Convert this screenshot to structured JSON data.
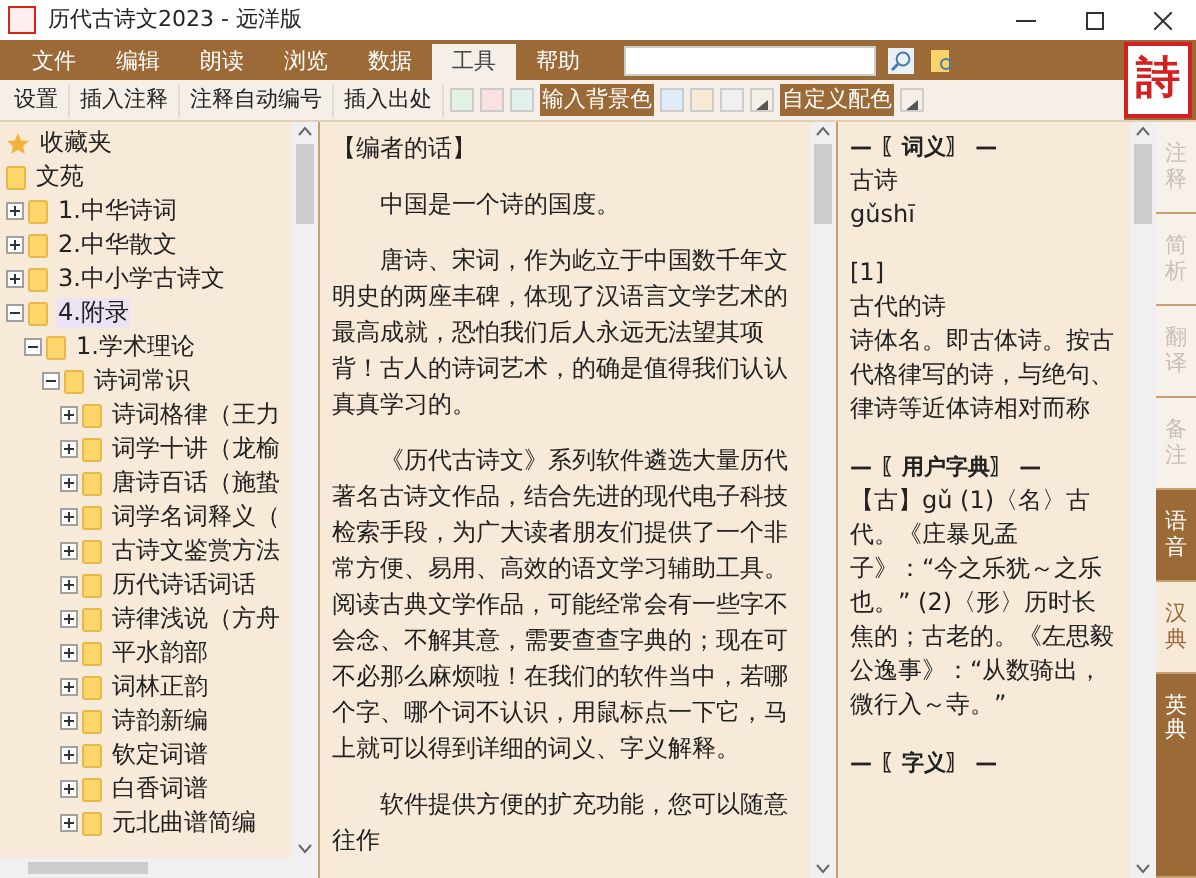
{
  "window": {
    "title": "历代古诗文2023 - 远洋版"
  },
  "menu": [
    {
      "label": "文件",
      "selected": false
    },
    {
      "label": "编辑",
      "selected": false
    },
    {
      "label": "朗读",
      "selected": false
    },
    {
      "label": "浏览",
      "selected": false
    },
    {
      "label": "数据",
      "selected": false
    },
    {
      "label": "工具",
      "selected": true
    },
    {
      "label": "帮助",
      "selected": false
    }
  ],
  "logo": "詩",
  "toolbar": [
    {
      "kind": "button",
      "label": "设置"
    },
    {
      "kind": "button",
      "label": "插入注释"
    },
    {
      "kind": "button",
      "label": "注释自动编号"
    },
    {
      "kind": "button",
      "label": "插入出处"
    },
    {
      "kind": "swatch",
      "color": "#e4f2e4"
    },
    {
      "kind": "swatch",
      "color": "#fbe2e2"
    },
    {
      "kind": "swatch",
      "color": "#e2f2ea"
    },
    {
      "kind": "label",
      "label": "输入背景色"
    },
    {
      "kind": "swatch",
      "color": "#e0ecf8"
    },
    {
      "kind": "swatch",
      "color": "#f8ebd6"
    },
    {
      "kind": "swatch",
      "color": "#f0f0f0"
    },
    {
      "kind": "arrow"
    },
    {
      "kind": "label",
      "label": "自定义配色"
    },
    {
      "kind": "arrow"
    }
  ],
  "tree": [
    {
      "kind": "star",
      "label": "收藏夹"
    },
    {
      "kind": "folder",
      "label": "文苑"
    },
    {
      "kind": "folder",
      "label": "1.中华诗词",
      "expanded": false
    },
    {
      "kind": "folder",
      "label": "2.中华散文",
      "expanded": false
    },
    {
      "kind": "folder",
      "label": "3.中小学古诗文",
      "expanded": false
    },
    {
      "kind": "folder",
      "label": "4.附录",
      "expanded": true,
      "selected": true,
      "children": [
        {
          "kind": "folder",
          "label": "1.学术理论",
          "expanded": true,
          "children": [
            {
              "kind": "folder",
              "label": "诗词常识",
              "expanded": true,
              "children": [
                {
                  "kind": "folder",
                  "label": "诗词格律（王力",
                  "expanded": false
                },
                {
                  "kind": "folder",
                  "label": "词学十讲（龙榆",
                  "expanded": false
                },
                {
                  "kind": "folder",
                  "label": "唐诗百话（施蛰",
                  "expanded": false
                },
                {
                  "kind": "folder",
                  "label": "词学名词释义（",
                  "expanded": false
                },
                {
                  "kind": "folder",
                  "label": "古诗文鉴赏方法",
                  "expanded": false
                },
                {
                  "kind": "folder",
                  "label": "历代诗话词话",
                  "expanded": false
                },
                {
                  "kind": "folder",
                  "label": "诗律浅说（方舟",
                  "expanded": false
                },
                {
                  "kind": "folder",
                  "label": "平水韵部",
                  "expanded": false
                },
                {
                  "kind": "folder",
                  "label": "词林正韵",
                  "expanded": false
                },
                {
                  "kind": "folder",
                  "label": "诗韵新编",
                  "expanded": false
                },
                {
                  "kind": "folder",
                  "label": "钦定词谱",
                  "expanded": false
                },
                {
                  "kind": "folder",
                  "label": "白香词谱",
                  "expanded": false
                },
                {
                  "kind": "folder",
                  "label": "元北曲谱简编",
                  "expanded": false
                }
              ]
            }
          ]
        }
      ]
    }
  ],
  "document": {
    "heading": "【编者的话】",
    "paragraphs": [
      "中国是一个诗的国度。",
      "唐诗、宋词，作为屹立于中国数千年文明史的两座丰碑，体现了汉语言文学艺术的最高成就，恐怕我们后人永远无法望其项背！古人的诗词艺术，的确是值得我们认认真真学习的。",
      "《历代古诗文》系列软件遴选大量历代著名古诗文作品，结合先进的现代电子科技检索手段，为广大读者朋友们提供了一个非常方便、易用、高效的语文学习辅助工具。阅读古典文学作品，可能经常会有一些字不会念、不解其意，需要查查字典的；现在可不必那么麻烦啦！在我们的软件当中，若哪个字、哪个词不认识，用鼠标点一下它，马上就可以得到详细的词义、字义解释。",
      "软件提供方便的扩充功能，您可以随意往作"
    ]
  },
  "dictionary": [
    {
      "kind": "heading",
      "text": "— 〖词义〗 —"
    },
    {
      "kind": "line",
      "text": "古诗"
    },
    {
      "kind": "line",
      "text": "gǔshī"
    },
    {
      "kind": "gap"
    },
    {
      "kind": "line",
      "text": "[1]"
    },
    {
      "kind": "line",
      "text": "古代的诗"
    },
    {
      "kind": "line",
      "text": "诗体名。即古体诗。按古代格律写的诗，与绝句、律诗等近体诗相对而称"
    },
    {
      "kind": "gap"
    },
    {
      "kind": "heading",
      "text": "— 〖用户字典〗 —"
    },
    {
      "kind": "line",
      "text": "【古】gǔ (1)〈名〉古代。《庄暴见孟子》：“今之乐犹～之乐也。” (2)〈形〉历时长焦的；古老的。《左思毅公逸事》：“从数骑出，微行入～寺。”"
    },
    {
      "kind": "gap"
    },
    {
      "kind": "heading",
      "text": "— 〖字义〗 —"
    }
  ],
  "side_tabs": [
    {
      "label": "注释",
      "disabled": true,
      "selected": false
    },
    {
      "label": "简析",
      "disabled": true,
      "selected": false
    },
    {
      "label": "翻译",
      "disabled": true,
      "selected": false
    },
    {
      "label": "备注",
      "disabled": true,
      "selected": false
    },
    {
      "label": "语音",
      "disabled": false,
      "selected": false
    },
    {
      "label": "汉典",
      "disabled": false,
      "selected": true
    },
    {
      "label": "英典",
      "disabled": false,
      "selected": false
    }
  ]
}
